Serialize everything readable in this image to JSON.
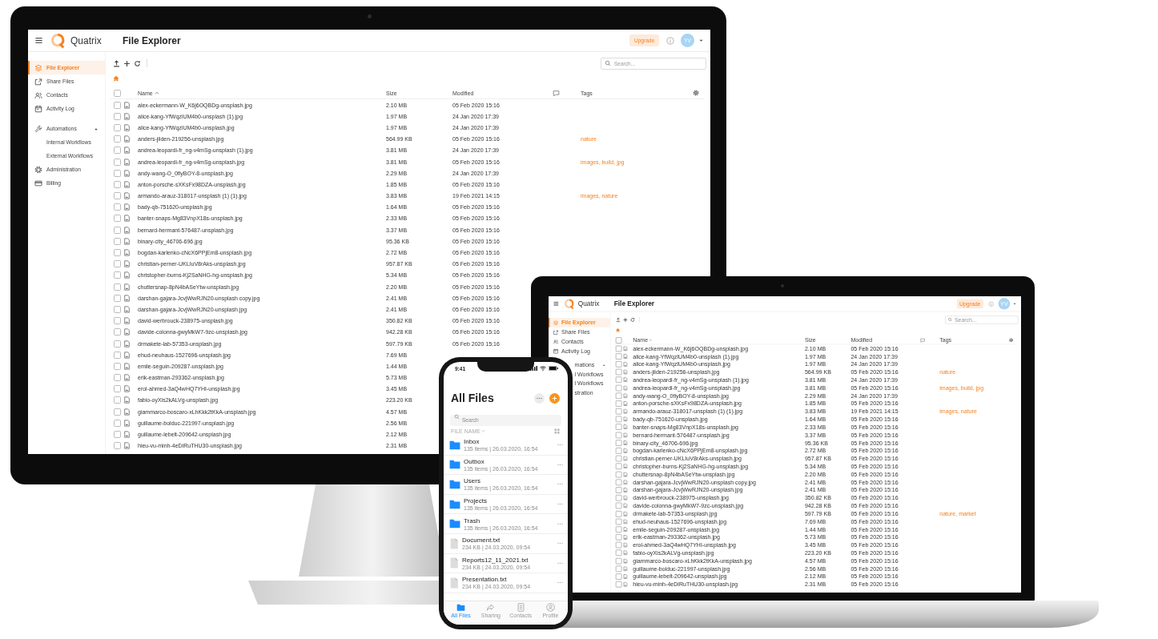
{
  "monitor": {
    "explorer": {
      "brand": "Quatrix",
      "title": "File Explorer",
      "upgrade": "Upgrade",
      "avatar": "YV",
      "search": {
        "placeholder": "Search..."
      },
      "sidebar": [
        {
          "label": "File Explorer",
          "kind": "nav",
          "selected": true
        },
        {
          "label": "Share Files",
          "kind": "nav",
          "selected": false
        },
        {
          "label": "Contacts",
          "kind": "nav",
          "selected": false
        },
        {
          "label": "Activity Log",
          "kind": "nav",
          "selected": false
        },
        {
          "label": "Automations",
          "kind": "group",
          "selected": false,
          "expanded": true
        },
        {
          "label": "Internal Workflows",
          "kind": "sub",
          "selected": false
        },
        {
          "label": "External Workflows",
          "kind": "sub",
          "selected": false
        },
        {
          "label": "Administration",
          "kind": "nav",
          "selected": false
        },
        {
          "label": "Billing",
          "kind": "nav",
          "selected": false
        }
      ],
      "columns": {
        "checked": false,
        "name": "Name",
        "size": "Size",
        "modified": "Modified",
        "tags": "Tags"
      },
      "rows": [
        {
          "checked": false,
          "name": "alex-eckermann-W_K6j6OQBDg-unsplash.jpg",
          "size": "2.10 MB",
          "modified": "05 Feb 2020 15:16"
        },
        {
          "checked": false,
          "name": "alice-kang-YfWqzlUM4b0-unsplash (1).jpg",
          "size": "1.97 MB",
          "modified": "24 Jan 2020 17:39"
        },
        {
          "checked": false,
          "name": "alice-kang-YfWqzlUM4b0-unsplash.jpg",
          "size": "1.97 MB",
          "modified": "24 Jan 2020 17:39"
        },
        {
          "checked": false,
          "name": "anders-jilden-219256-unsplash.jpg",
          "size": "564.99 KB",
          "modified": "05 Feb 2020 15:16",
          "tags": "nature"
        },
        {
          "checked": false,
          "name": "andrea-leopardi-fr_ng-v4mSg-unsplash (1).jpg",
          "size": "3.81 MB",
          "modified": "24 Jan 2020 17:39"
        },
        {
          "checked": false,
          "name": "andrea-leopardi-fr_ng-v4mSg-unsplash.jpg",
          "size": "3.81 MB",
          "modified": "05 Feb 2020 15:16",
          "tags": "images, build, jpg"
        },
        {
          "checked": false,
          "name": "andy-wang-O_0fiyBOY-8-unsplash.jpg",
          "size": "2.29 MB",
          "modified": "24 Jan 2020 17:39"
        },
        {
          "checked": false,
          "name": "anton-porsche-sXKsFx98DZA-unsplash.jpg",
          "size": "1.85 MB",
          "modified": "05 Feb 2020 15:16"
        },
        {
          "checked": false,
          "name": "armando-arauz-318017-unsplash (1) (1).jpg",
          "size": "3.83 MB",
          "modified": "19 Feb 2021 14:15",
          "tags": "images, nature"
        },
        {
          "checked": false,
          "name": "bady-qb-751620-unsplash.jpg",
          "size": "1.64 MB",
          "modified": "05 Feb 2020 15:16"
        },
        {
          "checked": false,
          "name": "banter-snaps-Mg83VnpX18s-unsplash.jpg",
          "size": "2.33 MB",
          "modified": "05 Feb 2020 15:16"
        },
        {
          "checked": false,
          "name": "bernard-hermant-576487-unsplash.jpg",
          "size": "3.37 MB",
          "modified": "05 Feb 2020 15:16"
        },
        {
          "checked": false,
          "name": "binary-city_46706-696.jpg",
          "size": "95.36 KB",
          "modified": "05 Feb 2020 15:16"
        },
        {
          "checked": false,
          "name": "bogdan-karlenko-cNcX6PPjEm8-unsplash.jpg",
          "size": "2.72 MB",
          "modified": "05 Feb 2020 15:16"
        },
        {
          "checked": false,
          "name": "christian-perner-UKLIuV8rAks-unsplash.jpg",
          "size": "957.87 KB",
          "modified": "05 Feb 2020 15:16"
        },
        {
          "checked": false,
          "name": "christopher-burns-Kj2SaNHG-hg-unsplash.jpg",
          "size": "5.34 MB",
          "modified": "05 Feb 2020 15:16"
        },
        {
          "checked": false,
          "name": "chuttersnap-8pN4bASeYtw-unsplash.jpg",
          "size": "2.20 MB",
          "modified": "05 Feb 2020 15:16"
        },
        {
          "checked": false,
          "name": "darshan-gajara-JcvjWwRJN20-unsplash copy.jpg",
          "size": "2.41 MB",
          "modified": "05 Feb 2020 15:16"
        },
        {
          "checked": false,
          "name": "darshan-gajara-JcvjWwRJN20-unsplash.jpg",
          "size": "2.41 MB",
          "modified": "05 Feb 2020 15:16"
        },
        {
          "checked": false,
          "name": "david-werbrouck-238975-unsplash.jpg",
          "size": "350.82 KB",
          "modified": "05 Feb 2020 15:16"
        },
        {
          "checked": false,
          "name": "davide-colonna-gwyMkW7-9zc-unsplash.jpg",
          "size": "942.28 KB",
          "modified": "05 Feb 2020 15:16"
        },
        {
          "checked": false,
          "name": "drmakete-lab-57353-unsplash.jpg",
          "size": "597.79 KB",
          "modified": "05 Feb 2020 15:16"
        },
        {
          "checked": false,
          "name": "ehud-neuhaus-1527696-unsplash.jpg",
          "size": "7.69 MB"
        },
        {
          "checked": false,
          "name": "emile-seguin-209287-unsplash.jpg",
          "size": "1.44 MB"
        },
        {
          "checked": false,
          "name": "erik-eastman-293362-unsplash.jpg",
          "size": "5.73 MB"
        },
        {
          "checked": false,
          "name": "erol-ahmed-3aQ4wHQ7YHI-unsplash.jpg",
          "size": "3.45 MB"
        },
        {
          "checked": false,
          "name": "fabio-oyXis2kALVg-unsplash.jpg",
          "size": "223.20 KB"
        },
        {
          "checked": false,
          "name": "giammarco-boscaro-xLhKkk2tKkA-unsplash.jpg",
          "size": "4.57 MB"
        },
        {
          "checked": false,
          "name": "guillaume-bolduc-221997-unsplash.jpg",
          "size": "2.56 MB"
        },
        {
          "checked": false,
          "name": "guillaume-lebelt-209642-unsplash.jpg",
          "size": "2.12 MB"
        },
        {
          "checked": false,
          "name": "hieu-vu-minh-4eDiRuTHU30-unsplash.jpg",
          "size": "2.31 MB"
        }
      ]
    }
  },
  "laptop": {
    "explorer": {
      "brand": "Quatrix",
      "title": "File Explorer",
      "upgrade": "Upgrade",
      "avatar": "YV",
      "search": {
        "placeholder": "Search..."
      },
      "sidebar": [
        {
          "label": "File Explorer",
          "kind": "nav",
          "selected": true
        },
        {
          "label": "Share Files",
          "kind": "nav",
          "selected": false
        },
        {
          "label": "Contacts",
          "kind": "nav",
          "selected": false
        },
        {
          "label": "Activity Log",
          "kind": "nav",
          "selected": false
        },
        {
          "label": "mations",
          "kind": "cutgroup",
          "selected": false,
          "expanded": true
        },
        {
          "label": "l Workflows",
          "kind": "cut",
          "selected": false
        },
        {
          "label": "l Workflows",
          "kind": "cut",
          "selected": false
        },
        {
          "label": "stration",
          "kind": "cut",
          "selected": false
        }
      ],
      "columns": {
        "checked": false,
        "name": "Name",
        "size": "Size",
        "modified": "Modified",
        "tags": "Tags"
      },
      "rows": [
        {
          "checked": false,
          "name": "alex-eckermann-W_K6j6OQBDg-unsplash.jpg",
          "size": "2.10 MB",
          "modified": "05 Feb 2020 15:16"
        },
        {
          "checked": false,
          "name": "alice-kang-YfWqzlUM4b0-unsplash (1).jpg",
          "size": "1.97 MB",
          "modified": "24 Jan 2020 17:39"
        },
        {
          "checked": false,
          "name": "alice-kang-YfWqzlUM4b0-unsplash.jpg",
          "size": "1.97 MB",
          "modified": "24 Jan 2020 17:39"
        },
        {
          "checked": false,
          "name": "anders-jilden-219256-unsplash.jpg",
          "size": "564.99 KB",
          "modified": "05 Feb 2020 15:16",
          "tags": "nature"
        },
        {
          "checked": false,
          "name": "andrea-leopardi-fr_ng-v4mSg-unsplash (1).jpg",
          "size": "3.81 MB",
          "modified": "24 Jan 2020 17:39"
        },
        {
          "checked": false,
          "name": "andrea-leopardi-fr_ng-v4mSg-unsplash.jpg",
          "size": "3.81 MB",
          "modified": "05 Feb 2020 15:16",
          "tags": "images, build, jpg"
        },
        {
          "checked": false,
          "name": "andy-wang-O_0fiyBOY-8-unsplash.jpg",
          "size": "2.29 MB",
          "modified": "24 Jan 2020 17:39"
        },
        {
          "checked": false,
          "name": "anton-porsche-sXKsFx98DZA-unsplash.jpg",
          "size": "1.85 MB",
          "modified": "05 Feb 2020 15:16"
        },
        {
          "checked": false,
          "name": "armando-arauz-318017-unsplash (1) (1).jpg",
          "size": "3.83 MB",
          "modified": "19 Feb 2021 14:15",
          "tags": "images, nature"
        },
        {
          "checked": false,
          "name": "bady-qb-751620-unsplash.jpg",
          "size": "1.64 MB",
          "modified": "05 Feb 2020 15:16"
        },
        {
          "checked": false,
          "name": "banter-snaps-Mg83VnpX18s-unsplash.jpg",
          "size": "2.33 MB",
          "modified": "05 Feb 2020 15:16"
        },
        {
          "checked": false,
          "name": "bernard-hermant-576487-unsplash.jpg",
          "size": "3.37 MB",
          "modified": "05 Feb 2020 15:16"
        },
        {
          "checked": false,
          "name": "binary-city_46706-696.jpg",
          "size": "95.36 KB",
          "modified": "05 Feb 2020 15:16"
        },
        {
          "checked": false,
          "name": "bogdan-karlenko-cNcX6PPjEm8-unsplash.jpg",
          "size": "2.72 MB",
          "modified": "05 Feb 2020 15:16"
        },
        {
          "checked": false,
          "name": "christian-perner-UKLIuV8rAks-unsplash.jpg",
          "size": "957.87 KB",
          "modified": "05 Feb 2020 15:16"
        },
        {
          "checked": false,
          "name": "christopher-burns-Kj2SaNHG-hg-unsplash.jpg",
          "size": "5.34 MB",
          "modified": "05 Feb 2020 15:16"
        },
        {
          "checked": false,
          "name": "chuttersnap-8pN4bASeYtw-unsplash.jpg",
          "size": "2.20 MB",
          "modified": "05 Feb 2020 15:16"
        },
        {
          "checked": false,
          "name": "darshan-gajara-JcvjWwRJN20-unsplash copy.jpg",
          "size": "2.41 MB",
          "modified": "05 Feb 2020 15:16"
        },
        {
          "checked": false,
          "name": "darshan-gajara-JcvjWwRJN20-unsplash.jpg",
          "size": "2.41 MB",
          "modified": "05 Feb 2020 15:16"
        },
        {
          "checked": false,
          "name": "david-werbrouck-238975-unsplash.jpg",
          "size": "350.82 KB",
          "modified": "05 Feb 2020 15:16"
        },
        {
          "checked": false,
          "name": "davide-colonna-gwyMkW7-9zc-unsplash.jpg",
          "size": "942.28 KB",
          "modified": "05 Feb 2020 15:16"
        },
        {
          "checked": false,
          "name": "drmakete-lab-57353-unsplash.jpg",
          "size": "597.79 KB",
          "modified": "05 Feb 2020 15:16",
          "tags": "nature, market"
        },
        {
          "checked": false,
          "name": "ehud-neuhaus-1527696-unsplash.jpg",
          "size": "7.69 MB",
          "modified": "05 Feb 2020 15:16"
        },
        {
          "checked": false,
          "name": "emile-seguin-209287-unsplash.jpg",
          "size": "1.44 MB",
          "modified": "05 Feb 2020 15:16"
        },
        {
          "checked": false,
          "name": "erik-eastman-293362-unsplash.jpg",
          "size": "5.73 MB",
          "modified": "05 Feb 2020 15:16"
        },
        {
          "checked": false,
          "name": "erol-ahmed-3aQ4wHQ7YHI-unsplash.jpg",
          "size": "3.45 MB",
          "modified": "05 Feb 2020 15:16"
        },
        {
          "checked": false,
          "name": "fabio-oyXis2kALVg-unsplash.jpg",
          "size": "223.20 KB",
          "modified": "05 Feb 2020 15:16"
        },
        {
          "checked": false,
          "name": "giammarco-boscaro-xLhKkk2tKkA-unsplash.jpg",
          "size": "4.57 MB",
          "modified": "05 Feb 2020 15:16"
        },
        {
          "checked": false,
          "name": "guillaume-bolduc-221997-unsplash.jpg",
          "size": "2.56 MB",
          "modified": "05 Feb 2020 15:16"
        },
        {
          "checked": false,
          "name": "guillaume-lebelt-209642-unsplash.jpg",
          "size": "2.12 MB",
          "modified": "05 Feb 2020 15:16"
        },
        {
          "checked": false,
          "name": "hieu-vu-minh-4eDiRuTHU30-unsplash.jpg",
          "size": "2.31 MB",
          "modified": "05 Feb 2020 15:16"
        }
      ]
    }
  },
  "phone": {
    "time": "9:41",
    "title": "All Files",
    "search": {
      "placeholder": "Search"
    },
    "sort_label": "FILE NAME",
    "items": [
      {
        "kind": "folder",
        "name": "Inbox",
        "meta": "135 items | 26.03.2020, 16:54"
      },
      {
        "kind": "folder",
        "name": "Outbox",
        "meta": "135 items | 26.03.2020, 16:54"
      },
      {
        "kind": "folder",
        "name": "Users",
        "meta": "135 items | 26.03.2020, 16:54"
      },
      {
        "kind": "folder",
        "name": "Projects",
        "meta": "135 items | 26.03.2020, 16:54"
      },
      {
        "kind": "folder",
        "name": "Trash",
        "meta": "135 items | 26.03.2020, 16:54"
      },
      {
        "kind": "file",
        "name": "Document.txt",
        "meta": "234 KB | 24.03.2020, 09:54"
      },
      {
        "kind": "file",
        "name": "Reports12_11_2021.txt",
        "meta": "234 KB | 24.03.2020, 09:54"
      },
      {
        "kind": "file",
        "name": "Presentation.txt",
        "meta": "234 KB | 24.03.2020, 09:54"
      }
    ],
    "tabs": [
      {
        "label": "All Files",
        "selected": true
      },
      {
        "label": "Sharing",
        "selected": false
      },
      {
        "label": "Contacts",
        "selected": false
      },
      {
        "label": "Profile",
        "selected": false
      }
    ]
  }
}
